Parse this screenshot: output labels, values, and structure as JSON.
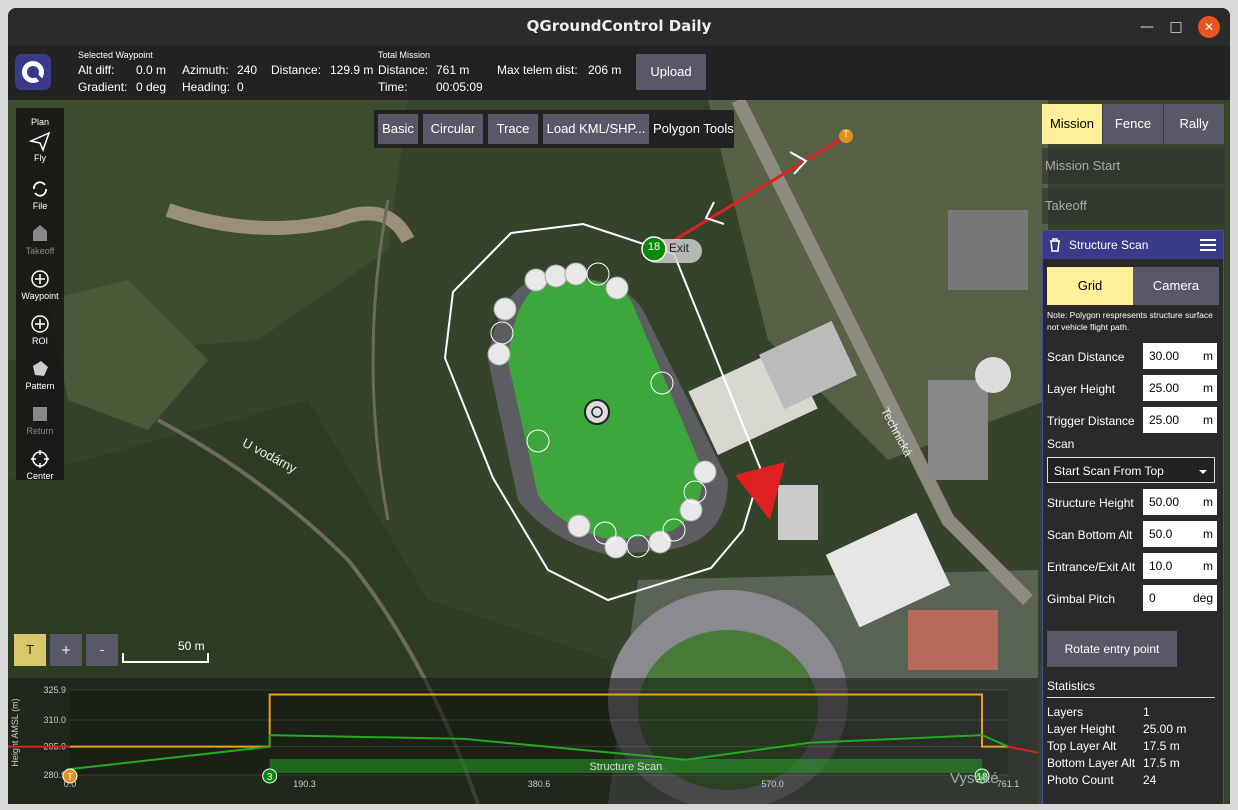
{
  "window": {
    "title": "QGroundControl Daily",
    "minimize": "—",
    "maximize": "□",
    "close": "✕"
  },
  "toolbar": {
    "selected_waypoint_label": "Selected Waypoint",
    "alt_diff_label": "Alt diff:",
    "alt_diff_value": "0.0 m",
    "gradient_label": "Gradient:",
    "gradient_value": "0 deg",
    "azimuth_label": "Azimuth:",
    "azimuth_value": "240",
    "heading_label": "Heading:",
    "heading_value": "0",
    "distance_label": "Distance:",
    "distance_value": "129.9 m",
    "total_mission_label": "Total Mission",
    "total_distance_label": "Distance:",
    "total_distance_value": "761 m",
    "time_label": "Time:",
    "time_value": "00:05:09",
    "max_telem_label": "Max telem dist:",
    "max_telem_value": "206 m",
    "upload_label": "Upload"
  },
  "plan_tools": [
    {
      "label": "Plan",
      "icon": "plan-header",
      "enabled": true
    },
    {
      "label": "Fly",
      "icon": "paper-plane-icon",
      "enabled": true
    },
    {
      "label": "File",
      "icon": "sync-icon",
      "enabled": true
    },
    {
      "label": "Takeoff",
      "icon": "takeoff-icon",
      "enabled": false
    },
    {
      "label": "Waypoint",
      "icon": "plus-circle-icon",
      "enabled": true
    },
    {
      "label": "ROI",
      "icon": "plus-circle-icon",
      "enabled": true
    },
    {
      "label": "Pattern",
      "icon": "pattern-icon",
      "enabled": true
    },
    {
      "label": "Return",
      "icon": "return-icon",
      "enabled": false
    },
    {
      "label": "Center",
      "icon": "crosshair-icon",
      "enabled": true
    }
  ],
  "polygon_tools": {
    "basic": "Basic",
    "circular": "Circular",
    "trace": "Trace",
    "load": "Load KML/SHP...",
    "title": "Polygon Tools"
  },
  "map_labels": {
    "street1": "U vodárny",
    "street2": "Technická",
    "street3": "Vysoké",
    "takeoff_marker": "T",
    "exit_number": "18",
    "exit_label": "Exit",
    "scale": "50 m"
  },
  "map_controls": {
    "t": "T",
    "plus": "+",
    "minus": "-"
  },
  "right_panel": {
    "tabs": [
      "Mission",
      "Fence",
      "Rally"
    ],
    "mission_start": "Mission Start",
    "takeoff": "Takeoff",
    "structure_scan": {
      "title": "Structure Scan",
      "grid_tab": "Grid",
      "camera_tab": "Camera",
      "note": "Note: Polygon respresents structure surface not vehicle flight path.",
      "scan_distance_label": "Scan Distance",
      "scan_distance": "30.00",
      "scan_distance_unit": "m",
      "layer_height_label": "Layer Height",
      "layer_height": "25.00",
      "layer_height_unit": "m",
      "trigger_distance_label": "Trigger Distance",
      "trigger_distance": "25.00",
      "trigger_distance_unit": "m",
      "scan_section": "Scan",
      "start_scan": "Start Scan From Top",
      "structure_height_label": "Structure Height",
      "structure_height": "50.00",
      "structure_height_unit": "m",
      "scan_bottom_alt_label": "Scan Bottom Alt",
      "scan_bottom_alt": "50.0",
      "scan_bottom_alt_unit": "m",
      "entrance_exit_alt_label": "Entrance/Exit Alt",
      "entrance_exit_alt": "10.0",
      "entrance_exit_alt_unit": "m",
      "gimbal_pitch_label": "Gimbal Pitch",
      "gimbal_pitch": "0",
      "gimbal_pitch_unit": "deg",
      "rotate_button": "Rotate entry point",
      "statistics_label": "Statistics",
      "stats": [
        {
          "label": "Layers",
          "value": "1"
        },
        {
          "label": "Layer Height",
          "value": "25.00 m"
        },
        {
          "label": "Top Layer Alt",
          "value": "17.5 m"
        },
        {
          "label": "Bottom Layer Alt",
          "value": "17.5 m"
        },
        {
          "label": "Photo Count",
          "value": "24"
        }
      ]
    }
  },
  "chart_data": {
    "type": "line",
    "ylabel": "Height AMSL (m)",
    "yticks": [
      "325.9",
      "310.0",
      "295.9",
      "280.9"
    ],
    "xticks": [
      "0.0",
      "190.3",
      "380.6",
      "570.0",
      "761.1"
    ],
    "ylim": [
      280.9,
      325.9
    ],
    "xlim": [
      0,
      761.1
    ],
    "series": [
      {
        "name": "flight",
        "color": "#f0a020",
        "x": [
          0,
          162,
          162,
          740,
          740,
          761.1
        ],
        "y": [
          295.9,
          295.9,
          323.5,
          323.5,
          295.9,
          295.9
        ]
      },
      {
        "name": "terrain",
        "color": "#22aa22",
        "x": [
          0,
          162,
          162,
          320,
          500,
          600,
          740,
          761.1
        ],
        "y": [
          284,
          295.9,
          302,
          300,
          289,
          298,
          302,
          296
        ]
      }
    ],
    "segment_label": "Structure Scan",
    "markers": [
      {
        "label": "T",
        "x": 0
      },
      {
        "label": "3",
        "x": 162
      },
      {
        "label": "18",
        "x": 740
      }
    ]
  }
}
